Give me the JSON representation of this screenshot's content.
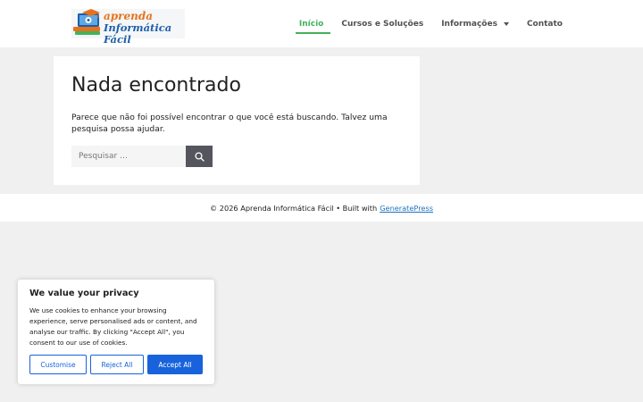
{
  "header": {
    "logo": {
      "line1": "aprenda",
      "line2": "Informática Fácil"
    },
    "nav": [
      {
        "label": "Início",
        "active": true
      },
      {
        "label": "Cursos e Soluções",
        "active": false
      },
      {
        "label": "Informações",
        "active": false,
        "has_dropdown": true
      },
      {
        "label": "Contato",
        "active": false
      }
    ]
  },
  "main": {
    "title": "Nada encontrado",
    "message": "Parece que não foi possível encontrar o que você está buscando. Talvez uma pesquisa possa ajudar.",
    "search": {
      "placeholder": "Pesquisar …",
      "value": "",
      "button_icon": "search-icon"
    }
  },
  "footer": {
    "copyright": "© 2026 Aprenda Informática Fácil • Built with",
    "link": "GeneratePress"
  },
  "cookie_banner": {
    "title": "We value your privacy",
    "text": "We use cookies to enhance your browsing experience, serve personalised ads or content, and analyse our traffic. By clicking \"Accept All\", you consent to our use of cookies.",
    "buttons": {
      "customise": "Customise",
      "reject": "Reject All",
      "accept": "Accept All"
    }
  },
  "colors": {
    "accent_green": "#43b25a",
    "nav_text": "#515151",
    "link_blue": "#1e73be",
    "cookie_blue": "#1863dc",
    "search_button": "#55555e",
    "page_background": "#f0f0f0"
  }
}
